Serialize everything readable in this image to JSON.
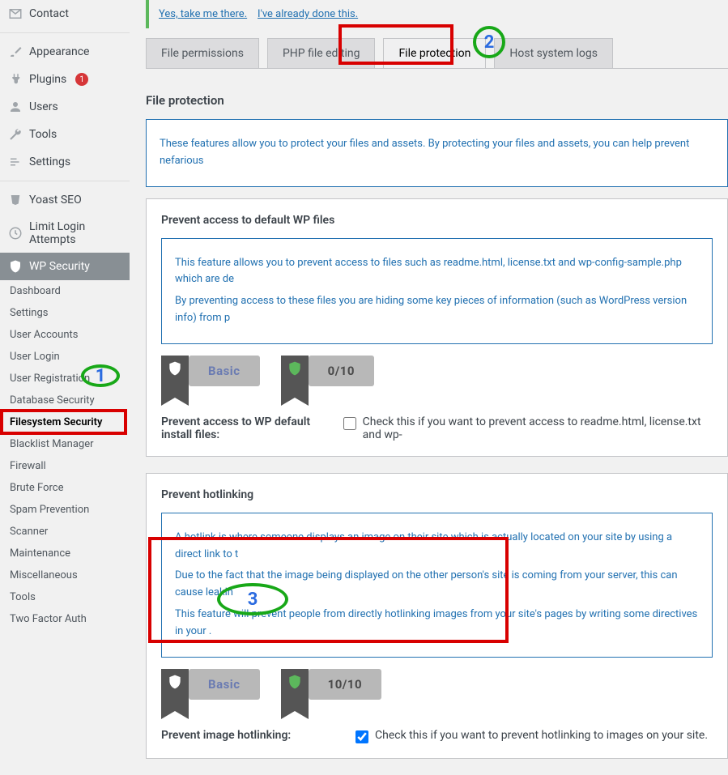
{
  "sidebar": {
    "top": [
      {
        "label": "Contact",
        "icon": "mail"
      },
      {
        "label": "Appearance",
        "icon": "brush"
      },
      {
        "label": "Plugins",
        "icon": "plug",
        "badge": "1"
      },
      {
        "label": "Users",
        "icon": "user"
      },
      {
        "label": "Tools",
        "icon": "wrench"
      },
      {
        "label": "Settings",
        "icon": "sliders"
      },
      {
        "label": "Yoast SEO",
        "icon": "yoast"
      },
      {
        "label": "Limit Login Attempts",
        "icon": "clock"
      },
      {
        "label": "WP Security",
        "icon": "shield",
        "active": true
      }
    ],
    "subs": [
      {
        "label": "Dashboard"
      },
      {
        "label": "Settings"
      },
      {
        "label": "User Accounts"
      },
      {
        "label": "User Login"
      },
      {
        "label": "User Registration"
      },
      {
        "label": "Database Security"
      },
      {
        "label": "Filesystem Security",
        "active": true
      },
      {
        "label": "Blacklist Manager"
      },
      {
        "label": "Firewall"
      },
      {
        "label": "Brute Force"
      },
      {
        "label": "Spam Prevention"
      },
      {
        "label": "Scanner"
      },
      {
        "label": "Maintenance"
      },
      {
        "label": "Miscellaneous"
      },
      {
        "label": "Tools"
      },
      {
        "label": "Two Factor Auth"
      }
    ]
  },
  "top_links": {
    "a": "Yes, take me there.",
    "b": "I've already done this."
  },
  "tabs": [
    "File permissions",
    "PHP file editing",
    "File protection",
    "Host system logs"
  ],
  "active_tab": 2,
  "heading": "File protection",
  "intro": "These features allow you to protect your files and assets. By protecting your files and assets, you can help prevent nefarious",
  "section1": {
    "title": "Prevent access to default WP files",
    "p1": "This feature allows you to prevent access to files such as readme.html, license.txt and wp-config-sample.php which are de",
    "p2": "By preventing access to these files you are hiding some key pieces of information (such as WordPress version info) from p",
    "badge": "Basic",
    "score": "0/10",
    "setting_label": "Prevent access to WP default install files:",
    "checkbox_desc": "Check this if you want to prevent access to readme.html, license.txt and wp-",
    "checked": false
  },
  "section2": {
    "title": "Prevent hotlinking",
    "p1": "A hotlink is where someone displays an image on their site which is actually located on your site by using a direct link to t",
    "p2": "Due to the fact that the image being displayed on the other person's site is coming from your server, this can cause leakin",
    "p3": "This feature will prevent people from directly hotlinking images from your site's pages by writing some directives in your .",
    "badge": "Basic",
    "score": "10/10",
    "setting_label": "Prevent image hotlinking:",
    "checkbox_desc": "Check this if you want to prevent hotlinking to images on your site.",
    "checked": true
  },
  "annotations": {
    "n1": "1",
    "n2": "2",
    "n3": "3"
  }
}
